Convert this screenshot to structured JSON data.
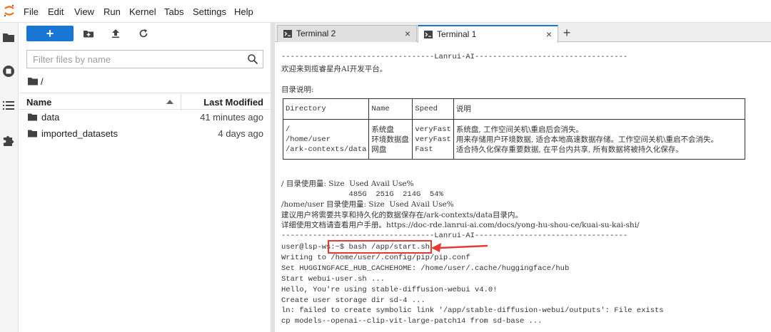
{
  "menu": [
    "File",
    "Edit",
    "View",
    "Run",
    "Kernel",
    "Tabs",
    "Settings",
    "Help"
  ],
  "filebrowser": {
    "new_label": "+",
    "filter_placeholder": "Filter files by name",
    "breadcrumb": "/",
    "columns": {
      "name": "Name",
      "modified": "Last Modified"
    },
    "files": [
      {
        "name": "data",
        "modified": "41 minutes ago"
      },
      {
        "name": "imported_datasets",
        "modified": "4 days ago"
      }
    ]
  },
  "tabs": [
    {
      "label": "Terminal 2",
      "close": "×",
      "active": false
    },
    {
      "label": "Terminal 1",
      "close": "×",
      "active": true
    }
  ],
  "tab_add": "+",
  "terminal": {
    "banner_top": "----------------------------------Lanrui-AI----------------------------------",
    "welcome": "欢迎来到揽睿星舟AI开发平台。",
    "dir_heading": "目录说明:",
    "table": {
      "headers": [
        "Directory",
        "Name",
        "Speed",
        "说明"
      ],
      "rows": [
        {
          "dir": "/",
          "name": "系统盘",
          "speed": "veryFast",
          "desc": "系统盘, 工作空间关机\\重启后会消失。"
        },
        {
          "dir": "/home/user",
          "name": "环境数据盘",
          "speed": "veryFast",
          "desc": "用来存储用户环境数据, 适合本地高速数据存储。工作空间关机\\重启不会消失。"
        },
        {
          "dir": "/ark-contexts/data",
          "name": "网盘",
          "speed": "Fast",
          "desc": "适合持久化保存重要数据, 在平台内共享, 所有数据将被持久化保存。"
        }
      ]
    },
    "usage_root_header": "/ 目录使用量: Size  Used Avail Use%",
    "usage_root_values": "               485G  251G  214G  54%",
    "usage_home_header": "/home/user 目录使用量: Size  Used Avail Use%",
    "advice": "建议用户将需要共享和持久化的数据保存在/ark-contexts/data目录内。",
    "manual": "详细使用文档请查看用户手册。https://doc-rde.lanrui-ai.com/docs/yong-hu-shou-ce/kuai-su-kai-shi/",
    "banner_bottom": "----------------------------------Lanrui-AI----------------------------------",
    "prompt": "user@lsp-ws:",
    "command": "~$ bash /app/start.sh",
    "output": [
      "Writing to /home/user/.config/pip/pip.conf",
      "Set HUGGINGFACE_HUB_CACHEHOME: /home/user/.cache/huggingface/hub",
      "Start webui-user.sh ...",
      "Hello, You're using stable-diffusion-webui v4.0!",
      "Create user storage dir sd-4 ...",
      "ln: failed to create symbolic link '/app/stable-diffusion-webui/outputs': File exists",
      "cp models--openai--clip-vit-large-patch14 from sd-base ..."
    ]
  },
  "colors": {
    "accent": "#1976d2",
    "highlight": "#e53935",
    "logo": "#f37626"
  }
}
